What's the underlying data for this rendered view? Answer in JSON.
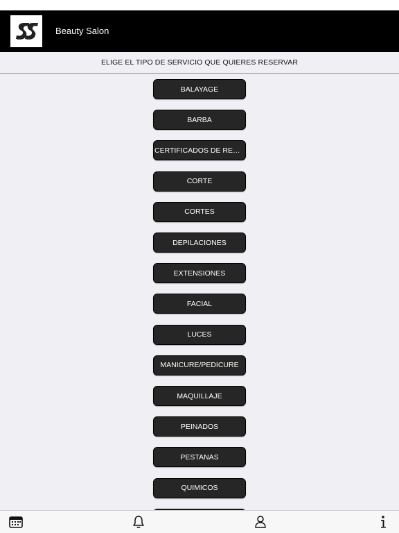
{
  "header": {
    "title": "Beauty Salon",
    "logo_icon": "salon-logo-icon"
  },
  "subheader": {
    "text": "ELIGE EL TIPO DE SERVICIO QUE QUIERES RESERVAR"
  },
  "services": [
    {
      "label": "BALAYAGE"
    },
    {
      "label": "BARBA"
    },
    {
      "label": "CERTIFICADOS DE REGA..."
    },
    {
      "label": "CORTE"
    },
    {
      "label": "CORTES"
    },
    {
      "label": "DEPILACIONES"
    },
    {
      "label": "EXTENSIONES"
    },
    {
      "label": "FACIAL"
    },
    {
      "label": "LUCES"
    },
    {
      "label": "MANICURE/PEDICURE"
    },
    {
      "label": "MAQUILLAJE"
    },
    {
      "label": "PEINADOS"
    },
    {
      "label": "PESTANAS"
    },
    {
      "label": "QUIMICOS"
    },
    {
      "label": ""
    }
  ],
  "tabbar": {
    "items": [
      {
        "icon": "calendar-icon"
      },
      {
        "icon": "bell-icon"
      },
      {
        "icon": "person-icon"
      },
      {
        "icon": "info-icon"
      }
    ]
  },
  "colors": {
    "header_bg": "#000000",
    "button_bg": "#262626",
    "page_bg": "#efeff4"
  }
}
